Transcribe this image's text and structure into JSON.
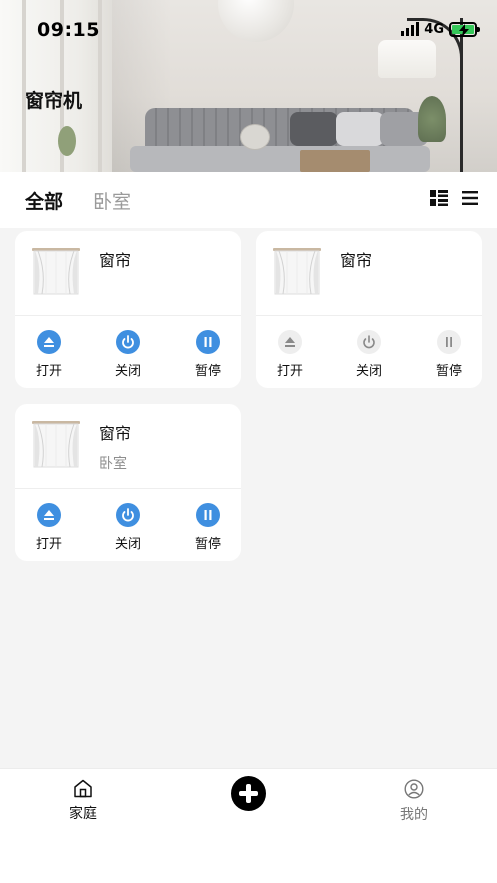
{
  "status_bar": {
    "time": "09:15",
    "network": "4G",
    "icons": [
      "signal-icon",
      "battery-charging-icon"
    ]
  },
  "header": {
    "title": "窗帘机"
  },
  "tabs": [
    {
      "label": "全部",
      "active": true
    },
    {
      "label": "卧室",
      "active": false
    }
  ],
  "view_toggles": [
    "grid-view-icon",
    "list-view-icon"
  ],
  "devices": [
    {
      "name": "窗帘",
      "room": "",
      "enabled": true,
      "controls": [
        {
          "label": "打开",
          "icon": "eject-open-icon"
        },
        {
          "label": "关闭",
          "icon": "power-icon"
        },
        {
          "label": "暂停",
          "icon": "pause-icon"
        }
      ]
    },
    {
      "name": "窗帘",
      "room": "",
      "enabled": false,
      "controls": [
        {
          "label": "打开",
          "icon": "eject-open-icon"
        },
        {
          "label": "关闭",
          "icon": "power-icon"
        },
        {
          "label": "暂停",
          "icon": "pause-icon"
        }
      ]
    },
    {
      "name": "窗帘",
      "room": "卧室",
      "enabled": true,
      "controls": [
        {
          "label": "打开",
          "icon": "eject-open-icon"
        },
        {
          "label": "关闭",
          "icon": "power-icon"
        },
        {
          "label": "暂停",
          "icon": "pause-icon"
        }
      ]
    }
  ],
  "bottom_nav": {
    "home_label": "家庭",
    "add_icon": "plus-icon",
    "mine_label": "我的"
  },
  "colors": {
    "accent": "#3f8fe0",
    "disabled": "#eeeeee",
    "background": "#f4f4f4"
  }
}
